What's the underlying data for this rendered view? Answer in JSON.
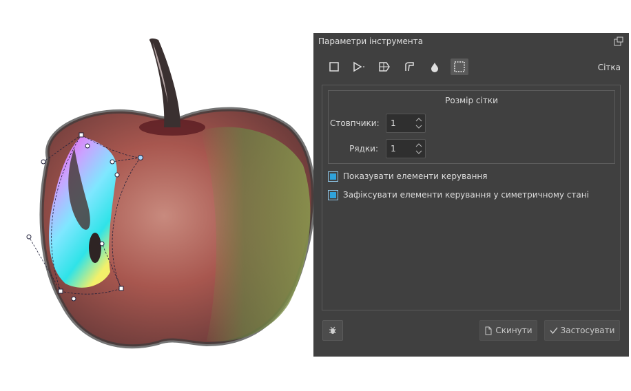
{
  "panel": {
    "title": "Параметри інструмента",
    "mode_label": "Сітка",
    "tools": [
      {
        "icon": "square-icon"
      },
      {
        "icon": "triangle-icon"
      },
      {
        "icon": "perspective-icon"
      },
      {
        "icon": "curve-icon"
      },
      {
        "icon": "drop-icon"
      },
      {
        "icon": "grid-selection-icon",
        "active": true
      }
    ],
    "grid_size_title": "Розмір сітки",
    "columns_label": "Стовпчики:",
    "columns_value": "1",
    "rows_label": "Рядки:",
    "rows_value": "1",
    "show_controls_label": "Показувати елементи керування",
    "lock_symmetric_label": "Зафіксувати елементи керування у симетричному стані",
    "reset_label": "Скинути",
    "apply_label": "Застосувати"
  }
}
